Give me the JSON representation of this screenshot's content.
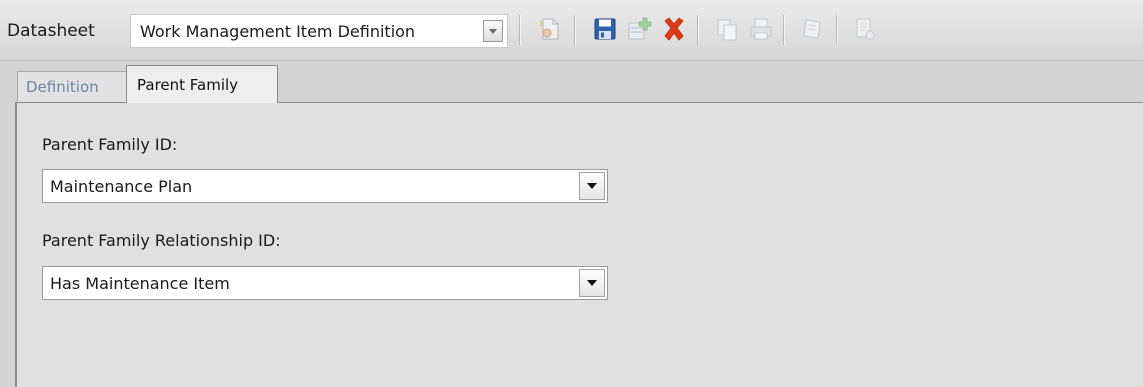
{
  "toolbar": {
    "datasheet_label": "Datasheet",
    "datasheet_value": "Work Management Item Definition",
    "icons": [
      "new-record-icon",
      "save-icon",
      "add-record-icon",
      "delete-icon",
      "copy-icon",
      "print-icon",
      "clear-icon",
      "report-icon"
    ],
    "colors": {
      "save": "#2a5fa8",
      "delete": "#e23a14",
      "disabled": "#b5bdc6"
    }
  },
  "tabs": [
    {
      "label": "Definition",
      "active": false
    },
    {
      "label": "Parent Family",
      "active": true
    }
  ],
  "form": {
    "parent_family_id": {
      "label": "Parent Family ID:",
      "value": "Maintenance Plan"
    },
    "parent_family_relationship_id": {
      "label": "Parent Family Relationship ID:",
      "value": "Has Maintenance Item"
    }
  }
}
